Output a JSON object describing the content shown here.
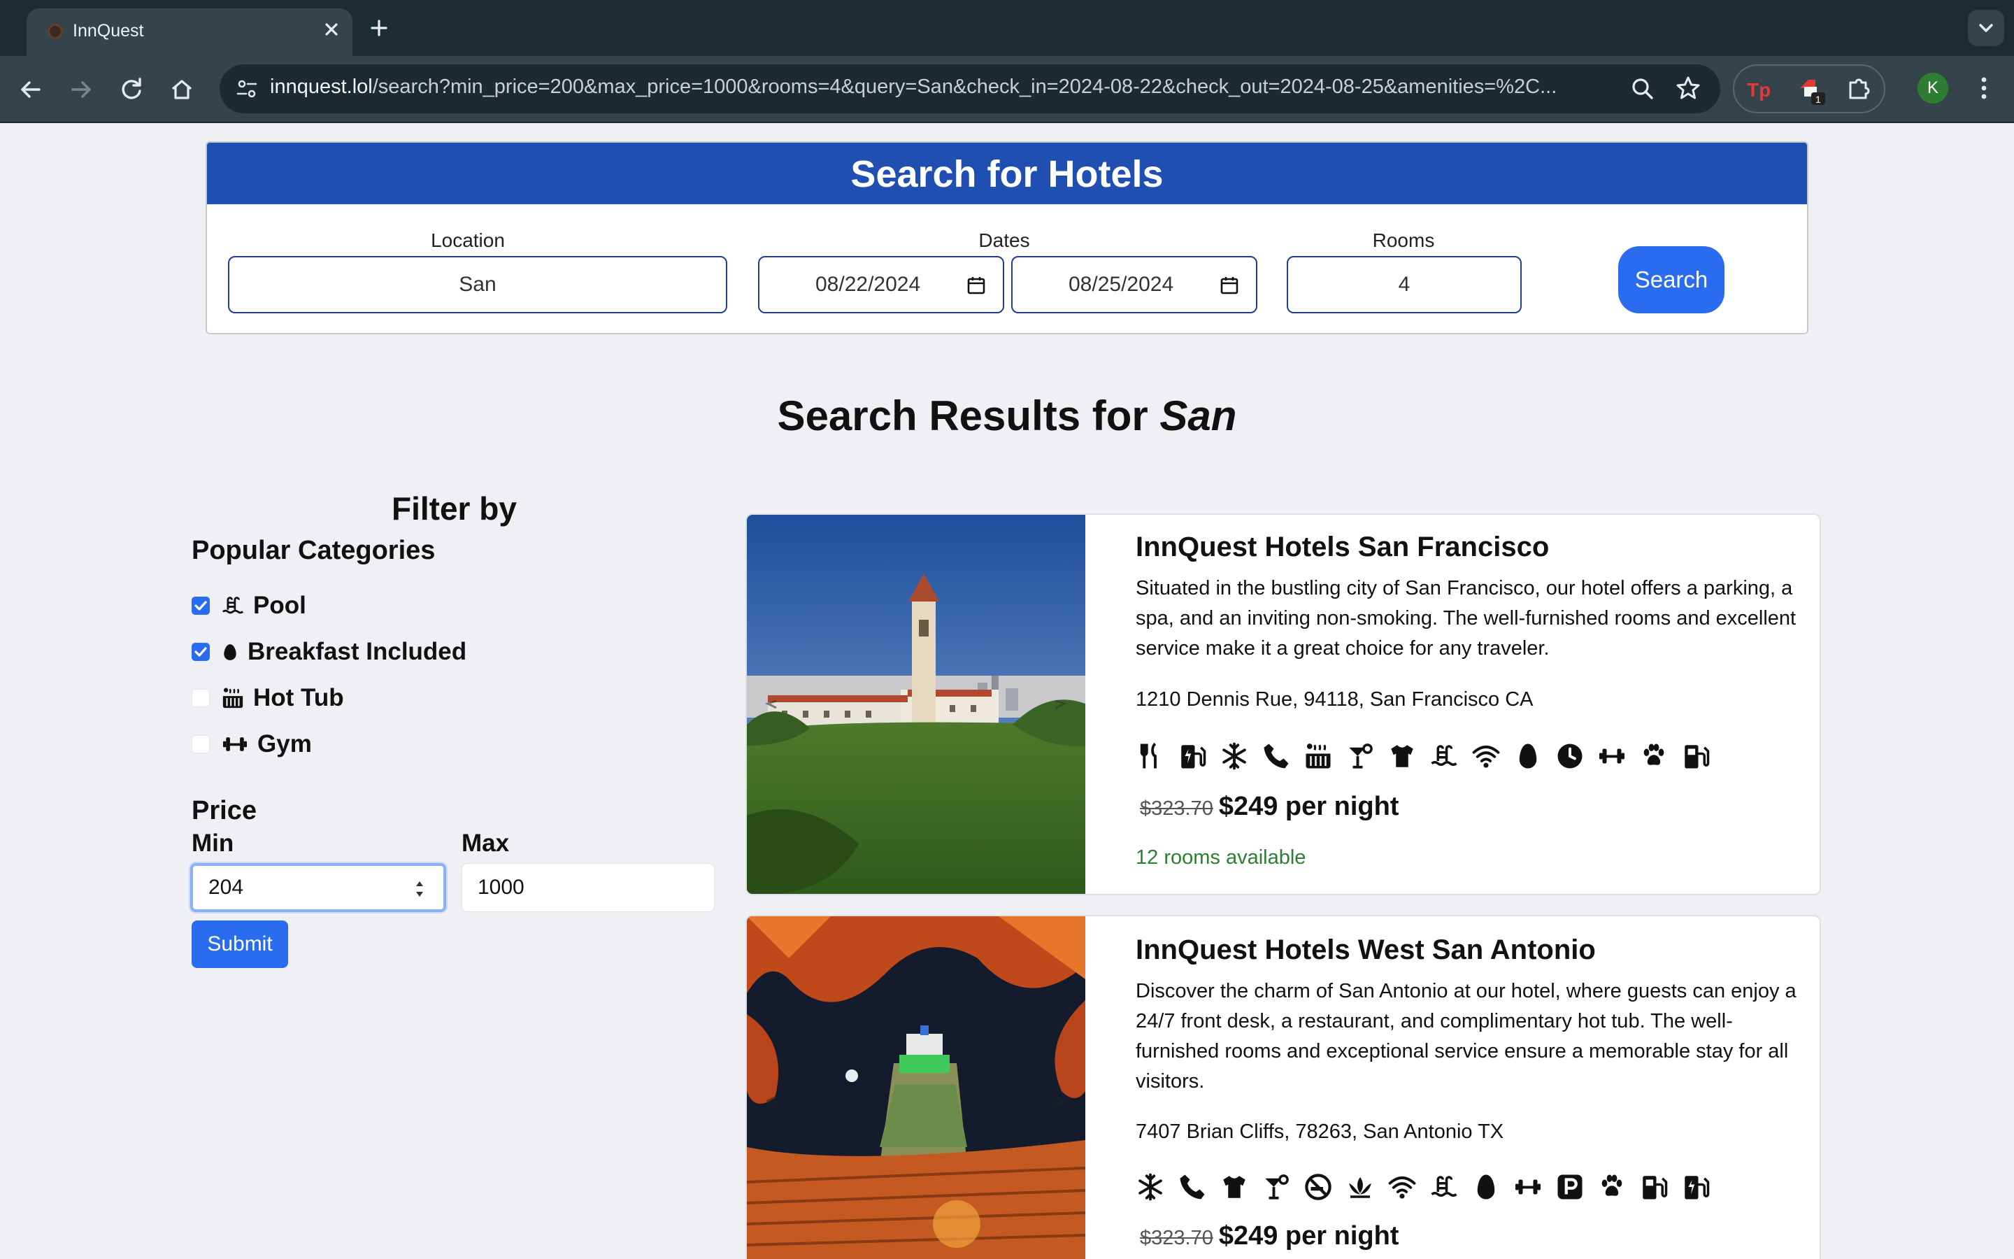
{
  "browser": {
    "tab_title": "InnQuest",
    "url_host": "innquest.lol",
    "url_path": "/search?min_price=200&max_price=1000&rooms=4&query=San&check_in=2024-08-22&check_out=2024-08-25&amenities=%2C...",
    "profile_initial": "K"
  },
  "search": {
    "title": "Search for Hotels",
    "location_label": "Location",
    "location_value": "San",
    "dates_label": "Dates",
    "check_in": "08/22/2024",
    "check_out": "08/25/2024",
    "rooms_label": "Rooms",
    "rooms_value": "4",
    "button": "Search"
  },
  "results": {
    "title_prefix": "Search Results for",
    "query": "San"
  },
  "filters": {
    "title": "Filter by",
    "categories_title": "Popular Categories",
    "categories": [
      {
        "label": "Pool",
        "icon": "pool-icon",
        "checked": true
      },
      {
        "label": "Breakfast Included",
        "icon": "egg-icon",
        "checked": true
      },
      {
        "label": "Hot Tub",
        "icon": "hot-tub-icon",
        "checked": false
      },
      {
        "label": "Gym",
        "icon": "dumbbell-icon",
        "checked": false
      }
    ],
    "price_title": "Price",
    "min_label": "Min",
    "min_value": "204",
    "max_label": "Max",
    "max_value": "1000",
    "submit": "Submit"
  },
  "hotels": [
    {
      "name": "InnQuest Hotels San Francisco",
      "description": "Situated in the bustling city of San Francisco, our hotel offers a parking, a spa, and an inviting non-smoking. The well-furnished rooms and excellent service make it a great choice for any traveler.",
      "address": "1210 Dennis Rue, 94118, San Francisco CA",
      "amenity_icons": [
        "utensils-icon",
        "ev-charger-icon",
        "snowflake-icon",
        "phone-icon",
        "hot-tub-icon",
        "cocktail-icon",
        "shirt-icon",
        "pool-icon",
        "wifi-icon",
        "egg-icon",
        "clock-icon",
        "dumbbell-icon",
        "paw-icon",
        "gas-pump-icon"
      ],
      "old_price": "$323.70",
      "price": "$249 per night",
      "availability": "12 rooms available"
    },
    {
      "name": "InnQuest Hotels West San Antonio",
      "description": "Discover the charm of San Antonio at our hotel, where guests can enjoy a 24/7 front desk, a restaurant, and complimentary hot tub. The well-furnished rooms and exceptional service ensure a memorable stay for all visitors.",
      "address": "7407 Brian Cliffs, 78263, San Antonio TX",
      "amenity_icons": [
        "snowflake-icon",
        "phone-icon",
        "shirt-icon",
        "cocktail-icon",
        "no-smoking-icon",
        "spa-icon",
        "wifi-icon",
        "pool-icon",
        "egg-icon",
        "dumbbell-icon",
        "parking-icon",
        "paw-icon",
        "gas-pump-icon",
        "ev-charger-icon"
      ],
      "old_price": "$323.70",
      "price": "$249 per night"
    }
  ]
}
